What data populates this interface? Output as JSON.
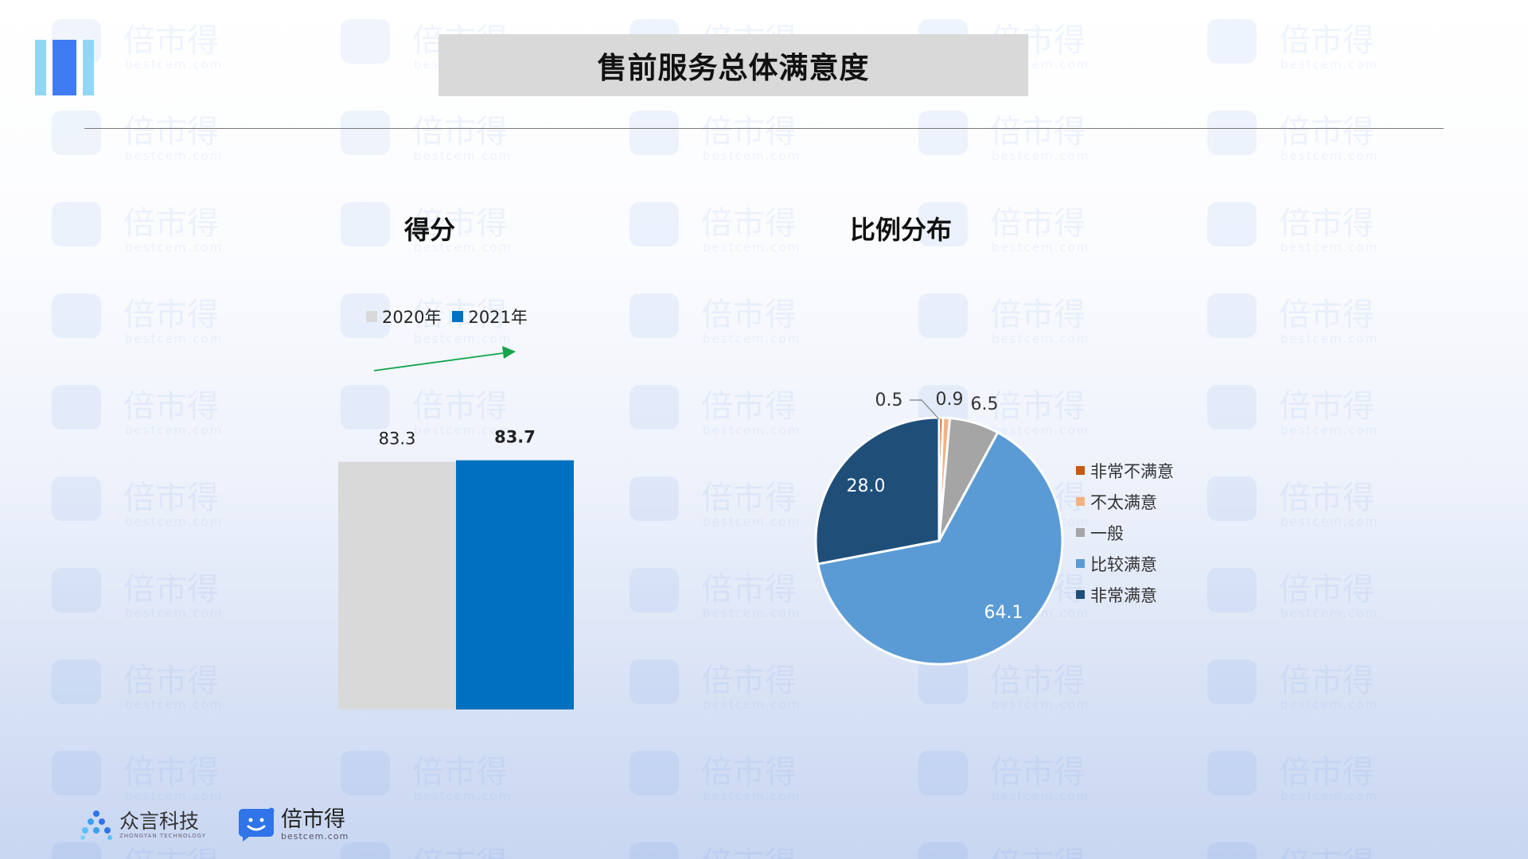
{
  "slide": {
    "title": "售前服务总体满意度"
  },
  "watermark": {
    "text": "倍市得",
    "sub": "bestcem.com"
  },
  "colors": {
    "bar_2020": "#d9d9d9",
    "bar_2021": "#0070c0",
    "arrow": "#16a34a",
    "pie_very_dissatisfied": "#c55a11",
    "pie_dissatisfied": "#f4b183",
    "pie_neutral": "#a5a5a5",
    "pie_satisfied": "#5b9bd5",
    "pie_very_satisfied": "#1f4e79"
  },
  "chart_data": [
    {
      "type": "bar",
      "title": "得分",
      "categories": [
        "2020年",
        "2021年"
      ],
      "values": [
        83.3,
        83.7
      ],
      "data_labels": [
        "83.3",
        "83.7"
      ],
      "legend": [
        "2020年",
        "2021年"
      ],
      "legend_position": "top",
      "ylim": [
        0,
        100
      ],
      "grid": false,
      "annotation": "green upward arrow indicating increase"
    },
    {
      "type": "pie",
      "title": "比例分布",
      "labels": [
        "非常不满意",
        "不太满意",
        "一般",
        "比较满意",
        "非常满意"
      ],
      "values": [
        0.5,
        0.9,
        6.5,
        64.1,
        28.0
      ],
      "data_labels": [
        "0.5",
        "0.9",
        "6.5",
        "64.1",
        "28.0"
      ],
      "legend_position": "right"
    }
  ],
  "footer": {
    "brand1": {
      "name": "众言科技",
      "sub": "ZHONGYAN TECHNOLOGY",
      "icon": "dots-logo-icon"
    },
    "brand2": {
      "name": "倍市得",
      "sub": "bestcem.com",
      "icon": "chat-smile-icon"
    }
  }
}
